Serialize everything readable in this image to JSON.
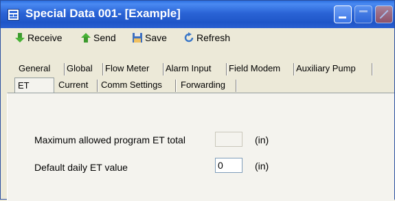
{
  "window": {
    "title": "Special Data 001- [Example]"
  },
  "toolbar": {
    "receive_label": "Receive",
    "send_label": "Send",
    "save_label": "Save",
    "refresh_label": "Refresh"
  },
  "tabs": {
    "row1": [
      "General",
      "Global",
      "Flow Meter",
      "Alarm Input",
      "Field Modem",
      "Auxiliary Pump"
    ],
    "row2": [
      "ET",
      "Current",
      "Comm Settings",
      "Forwarding"
    ],
    "active": "ET"
  },
  "form": {
    "max_et_label": "Maximum allowed program ET total",
    "max_et_value": "",
    "max_et_unit": "(in)",
    "daily_et_label": "Default daily ET value",
    "daily_et_value": "0",
    "daily_et_unit": "(in)"
  },
  "colors": {
    "titlebar": "#2a64d6",
    "window_bg": "#ece9d8",
    "panel_bg": "#f4f3ee"
  }
}
